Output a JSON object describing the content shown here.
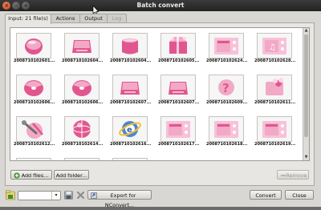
{
  "window": {
    "title": "Batch convert"
  },
  "tabs": [
    {
      "label": "Input: 21 file(s)",
      "active": true,
      "enabled": true
    },
    {
      "label": "Actions",
      "active": false,
      "enabled": true
    },
    {
      "label": "Output",
      "active": false,
      "enabled": true
    },
    {
      "label": "Log",
      "active": false,
      "enabled": false
    }
  ],
  "files": [
    {
      "name": "2008710102601...",
      "icon": "pink-button-icon"
    },
    {
      "name": "2008710102604...",
      "icon": "pink-drive-icon"
    },
    {
      "name": "2008710102604...",
      "icon": "pink-cup-icon"
    },
    {
      "name": "2008710102605...",
      "icon": "pink-gift-icon"
    },
    {
      "name": "2008710102624...",
      "icon": "pink-folder-icon"
    },
    {
      "name": "2008710102628...",
      "icon": "pink-music-folder-icon"
    },
    {
      "name": "2008710102606...",
      "icon": "pink-disk-icon"
    },
    {
      "name": "2008710102606...",
      "icon": "pink-disk-icon"
    },
    {
      "name": "2008710102607...",
      "icon": "pink-drive-icon"
    },
    {
      "name": "2008710102607...",
      "icon": "pink-drive-icon"
    },
    {
      "name": "2008710102609...",
      "icon": "pink-help-icon"
    },
    {
      "name": "2008710102611...",
      "icon": "pink-flower-icon"
    },
    {
      "name": "2008710102612...",
      "icon": "pink-tools-icon"
    },
    {
      "name": "2008710102614...",
      "icon": "pink-globe-icon"
    },
    {
      "name": "2008710102616...",
      "icon": "pink-browser-icon"
    },
    {
      "name": "2008710102617...",
      "icon": "pink-folder-icon"
    },
    {
      "name": "2008710102618...",
      "icon": "pink-folder-icon"
    },
    {
      "name": "2008710102619...",
      "icon": "pink-folder-icon"
    },
    {
      "name": "",
      "icon": "pink-folder-icon"
    },
    {
      "name": "",
      "icon": "pink-folder-icon"
    },
    {
      "name": "",
      "icon": "pink-folder-icon"
    }
  ],
  "buttons": {
    "add_files": "Add files...",
    "add_folder": "Add folder...",
    "remove": "Remove",
    "export": "Export for NConvert...",
    "convert": "Convert",
    "close": "Close"
  },
  "colors": {
    "accent_pink": "#f2a9c6",
    "deep_pink": "#e2568f",
    "folder_pink": "#f7c2d8"
  }
}
